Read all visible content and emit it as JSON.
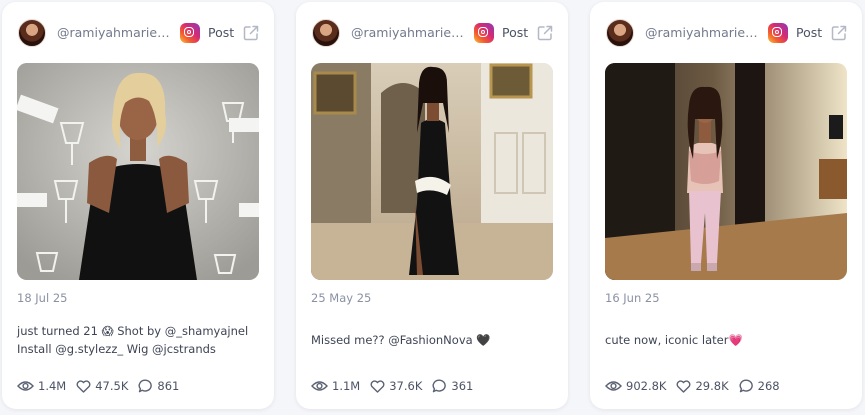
{
  "posts": [
    {
      "handle": "@ramiyahmarie…",
      "platform_icon": "instagram-icon",
      "post_label": "Post",
      "date": "18 Jul 25",
      "caption_line1": "just turned 21 😱 Shot by @_shamyajnel",
      "caption_line2": "Install @g.stylezz_ Wig @jcstrands",
      "views": "1.4M",
      "likes": "47.5K",
      "comments": "861"
    },
    {
      "handle": "@ramiyahmarie…",
      "platform_icon": "instagram-icon",
      "post_label": "Post",
      "date": "25 May 25",
      "caption_line1": "Missed me?? @FashionNova 🖤",
      "caption_line2": "",
      "views": "1.1M",
      "likes": "37.6K",
      "comments": "361"
    },
    {
      "handle": "@ramiyahmarie…",
      "platform_icon": "instagram-icon",
      "post_label": "Post",
      "date": "16 Jun 25",
      "caption_line1": "cute now, iconic later💗",
      "caption_line2": "",
      "views": "902.8K",
      "likes": "29.8K",
      "comments": "268"
    }
  ],
  "colors": {
    "page_bg": "#f5f6f9",
    "card_bg": "#ffffff",
    "muted_text": "#8a91a3",
    "body_text": "#3e4455"
  }
}
